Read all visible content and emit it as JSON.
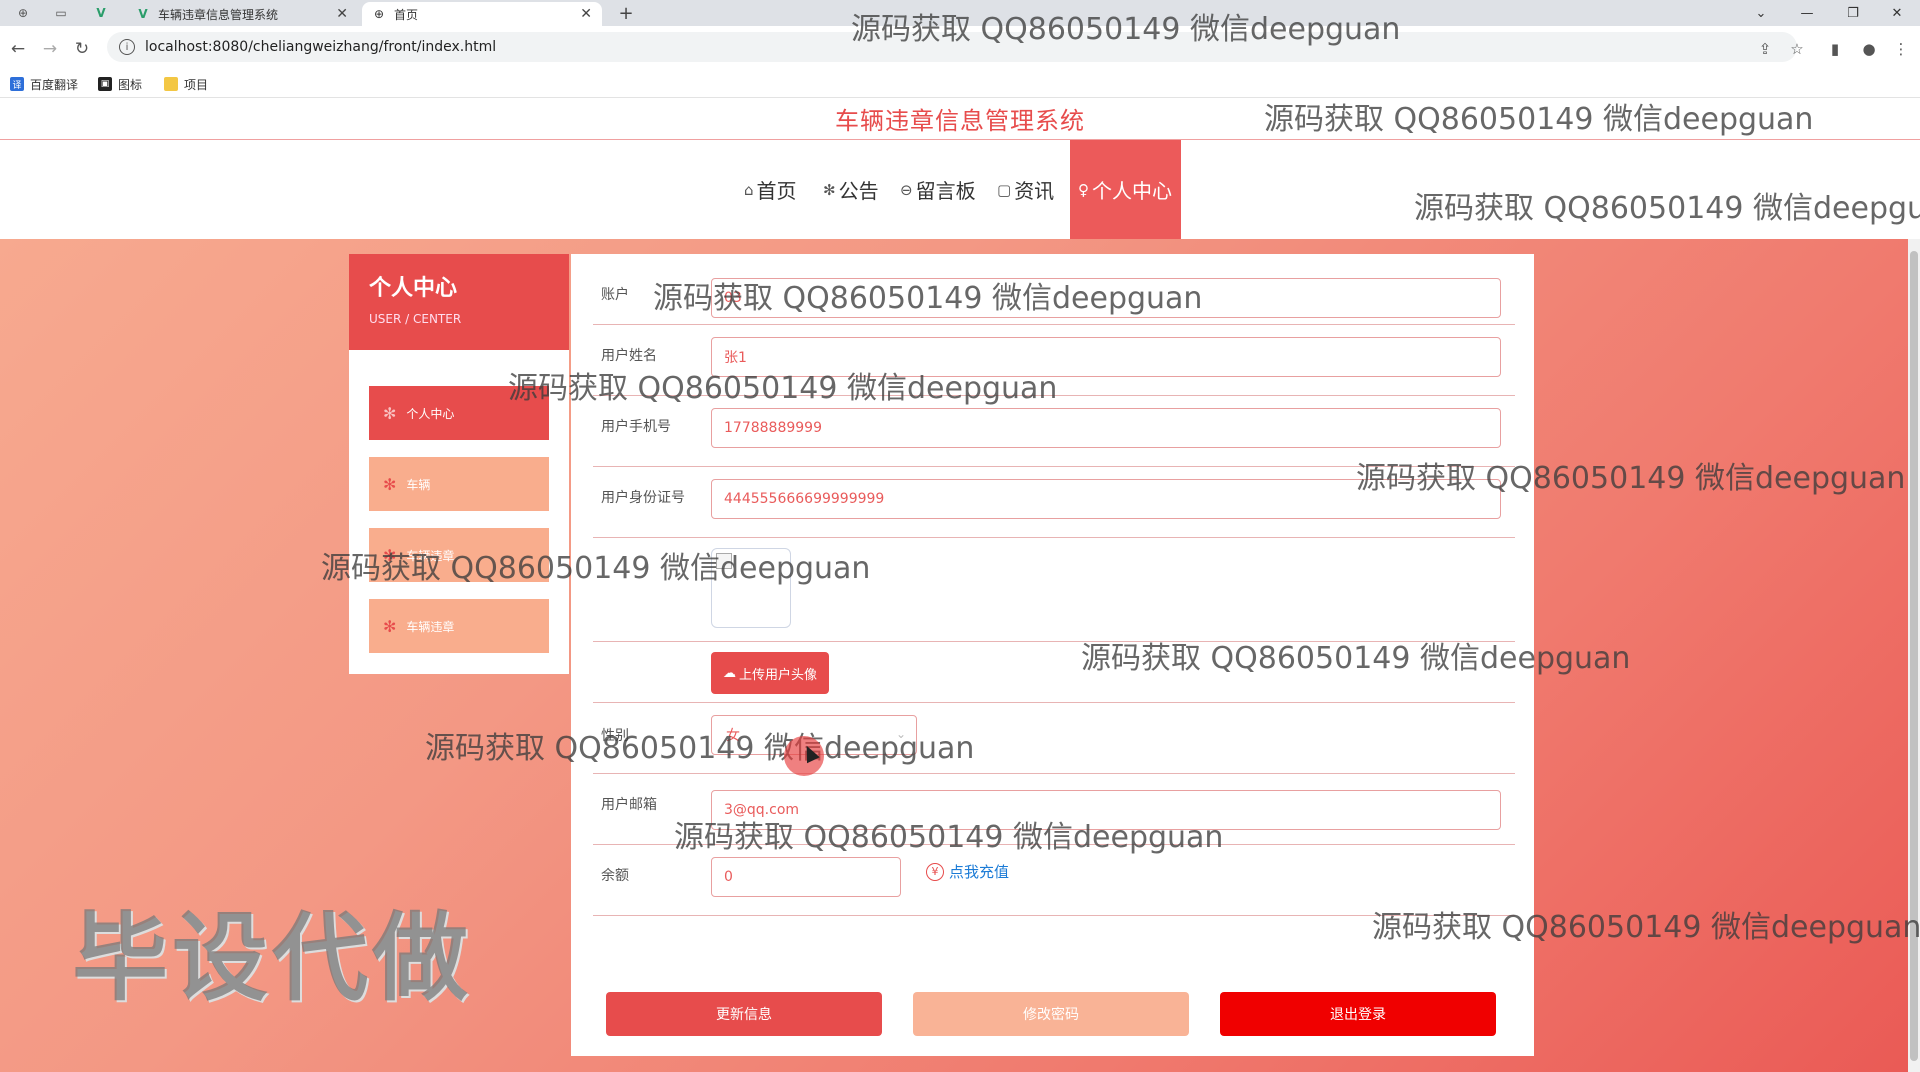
{
  "browser": {
    "tabs": [
      {
        "title": "车辆违章信息管理系统",
        "active": false
      },
      {
        "title": "首页",
        "active": true
      }
    ],
    "url": "localhost:8080/cheliangweizhang/front/index.html",
    "bookmarks": [
      "百度翻译",
      "图标",
      "项目"
    ]
  },
  "site": {
    "title": "车辆违章信息管理系统",
    "nav": [
      {
        "icon": "⌂",
        "label": "首页"
      },
      {
        "icon": "✻",
        "label": "公告"
      },
      {
        "icon": "⊖",
        "label": "留言板"
      },
      {
        "icon": "▢",
        "label": "资讯"
      },
      {
        "icon": "♀",
        "label": "个人中心",
        "active": true
      }
    ]
  },
  "sidebar": {
    "title": "个人中心",
    "subtitle": "USER / CENTER",
    "items": [
      {
        "label": "个人中心",
        "active": true
      },
      {
        "label": "车辆"
      },
      {
        "label": "车辆违章"
      },
      {
        "label": "车辆违章"
      }
    ]
  },
  "form": {
    "account_label": "账户",
    "account_value": "03",
    "name_label": "用户姓名",
    "name_value": "张1",
    "phone_label": "用户手机号",
    "phone_value": "17788889999",
    "idcard_label": "用户身份证号",
    "idcard_value": "444555666699999999",
    "upload_label": "上传用户头像",
    "gender_label": "性别",
    "gender_value": "女",
    "email_label": "用户邮箱",
    "email_value": "3@qq.com",
    "balance_label": "余额",
    "balance_value": "0",
    "recharge_label": "点我充值"
  },
  "actions": {
    "update": "更新信息",
    "change_password": "修改密码",
    "logout": "退出登录"
  },
  "colors": {
    "accent": "#e74c4c",
    "soft": "#f9ad8d",
    "logout": "#f00000"
  },
  "overlays": {
    "watermark": "源码获取 QQ86050149 微信deepguan",
    "stamp": "毕设代做"
  }
}
